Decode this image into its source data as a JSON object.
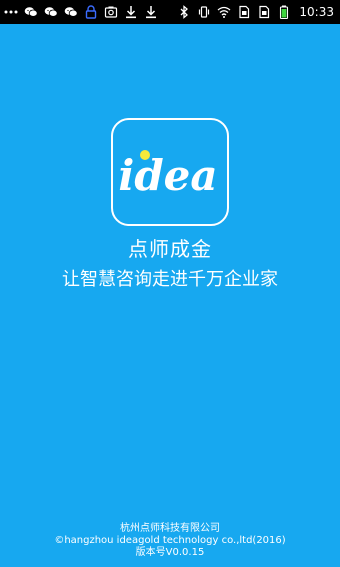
{
  "status_bar": {
    "time": "10:33",
    "left_icons": [
      "more-icon",
      "wechat-icon",
      "wechat-icon",
      "wechat-icon",
      "lock-icon",
      "screenshot-icon",
      "download-icon",
      "download-icon"
    ],
    "right_icons": [
      "bluetooth-icon",
      "vibrate-icon",
      "wifi-icon",
      "sim-icon",
      "sim-icon",
      "battery-icon"
    ]
  },
  "logo": {
    "text": "idea",
    "dot_color": "#f7ea3a"
  },
  "brand": {
    "title": "点师成金",
    "slogan": "让智慧咨询走进千万企业家"
  },
  "footer": {
    "company": "杭州点师科技有限公司",
    "copyright": "©hangzhou ideagold technology co.,ltd(2016)",
    "version": "版本号V0.0.15"
  },
  "colors": {
    "background": "#17a8f0",
    "status_bar": "#000000",
    "text": "#ffffff"
  }
}
